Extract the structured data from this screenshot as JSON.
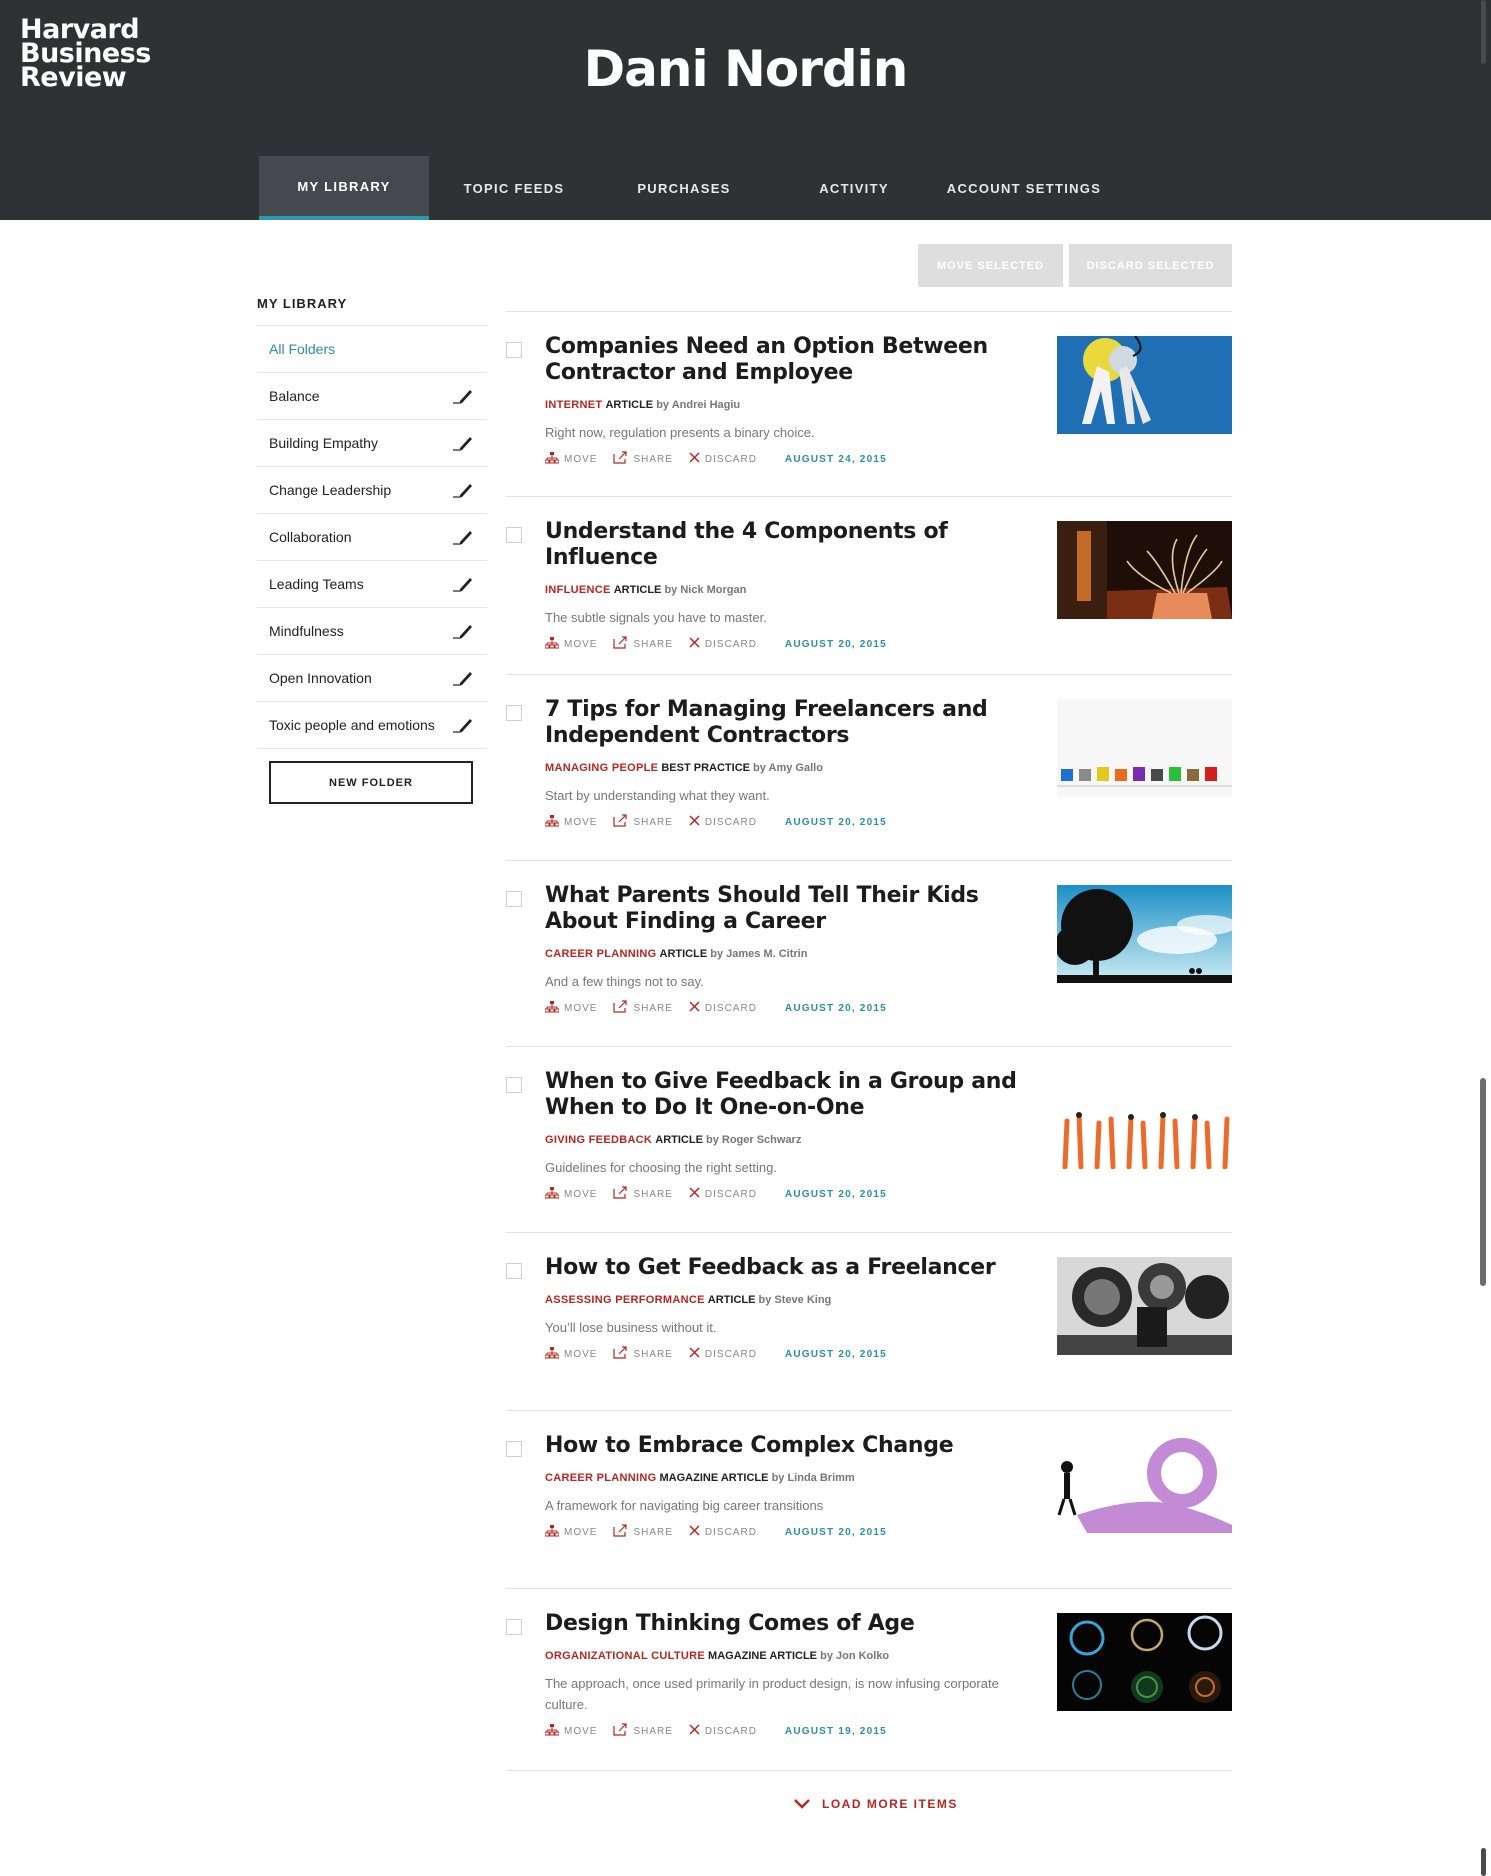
{
  "brand": {
    "line1": "Harvard",
    "line2": "Business",
    "line3": "Review"
  },
  "user": {
    "name": "Dani Nordin"
  },
  "nav": {
    "tabs": [
      {
        "label": "MY LIBRARY"
      },
      {
        "label": "TOPIC FEEDS"
      },
      {
        "label": "PURCHASES"
      },
      {
        "label": "ACTIVITY"
      },
      {
        "label": "ACCOUNT SETTINGS"
      }
    ]
  },
  "toolbar": {
    "move_label": "MOVE SELECTED",
    "discard_label": "DISCARD SELECTED"
  },
  "sidebar": {
    "title": "MY LIBRARY",
    "folders": [
      {
        "label": "All Folders"
      },
      {
        "label": "Balance"
      },
      {
        "label": "Building Empathy"
      },
      {
        "label": "Change Leadership"
      },
      {
        "label": "Collaboration"
      },
      {
        "label": "Leading Teams"
      },
      {
        "label": "Mindfulness"
      },
      {
        "label": "Open Innovation"
      },
      {
        "label": "Toxic people and emotions"
      }
    ],
    "new_folder_label": "NEW FOLDER"
  },
  "actions": {
    "move": "MOVE",
    "share": "SHARE",
    "discard": "DISCARD"
  },
  "articles": [
    {
      "title": "Companies Need an Option Between Contractor and Employee",
      "topic": "INTERNET",
      "type": "ARTICLE",
      "author": "by Andrei Hagiu",
      "summary": "Right now, regulation presents a binary choice.",
      "date": "AUGUST 24, 2015"
    },
    {
      "title": "Understand the 4 Components of Influence",
      "topic": "INFLUENCE",
      "type": "ARTICLE",
      "author": "by Nick Morgan",
      "summary": "The subtle signals you have to master.",
      "date": "AUGUST 20, 2015"
    },
    {
      "title": "7 Tips for Managing Freelancers and Independent Contractors",
      "topic": "MANAGING PEOPLE",
      "type": "BEST PRACTICE",
      "author": "by Amy Gallo",
      "summary": "Start by understanding what they want.",
      "date": "AUGUST 20, 2015"
    },
    {
      "title": "What Parents Should Tell Their Kids About Finding a Career",
      "topic": "CAREER PLANNING",
      "type": "ARTICLE",
      "author": "by James M. Citrin",
      "summary": "And a few things not to say.",
      "date": "AUGUST 20, 2015"
    },
    {
      "title": "When to Give Feedback in a Group and When to Do It One-on-One",
      "topic": "GIVING FEEDBACK",
      "type": "ARTICLE",
      "author": "by Roger Schwarz",
      "summary": "Guidelines for choosing the right setting.",
      "date": "AUGUST 20, 2015"
    },
    {
      "title": "How to Get Feedback as a Freelancer",
      "topic": "ASSESSING PERFORMANCE",
      "type": "ARTICLE",
      "author": "by Steve King",
      "summary": "You’ll lose business without it.",
      "date": "AUGUST 20, 2015"
    },
    {
      "title": "How to Embrace Complex Change",
      "topic": "CAREER PLANNING",
      "type": "MAGAZINE ARTICLE",
      "author": "by Linda Brimm",
      "summary": "A framework for navigating big career transitions",
      "date": "AUGUST 20, 2015"
    },
    {
      "title": "Design Thinking Comes of Age",
      "topic": "ORGANIZATIONAL CULTURE",
      "type": "MAGAZINE ARTICLE",
      "author": "by Jon Kolko",
      "summary": "The approach, once used primarily in product design, is now infusing corporate culture.",
      "date": "AUGUST 19, 2015"
    }
  ],
  "load_more_label": "LOAD MORE ITEMS",
  "colors": {
    "header_bg": "#2f3135",
    "accent_teal": "#2c8fa3",
    "accent_red": "#b8261f"
  }
}
